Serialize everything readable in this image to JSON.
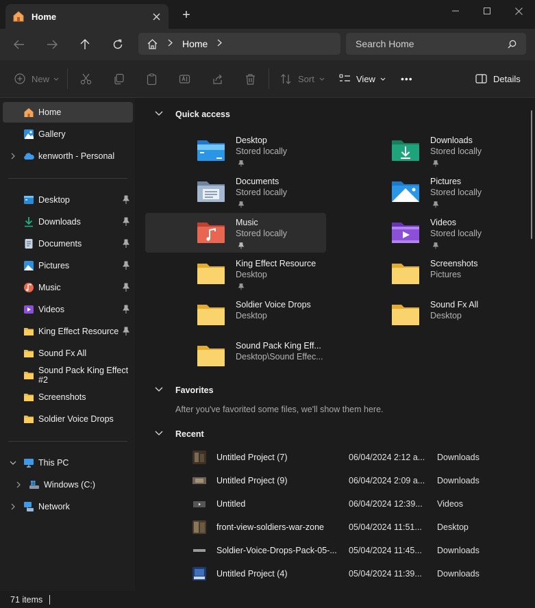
{
  "window": {
    "tab_title": "Home",
    "new_tab_symbol": "+"
  },
  "navbar": {
    "crumb_home": "Home",
    "search_placeholder": "Search Home"
  },
  "toolbar": {
    "new_label": "New",
    "sort_label": "Sort",
    "view_label": "View",
    "more_label": "•••",
    "details_label": "Details"
  },
  "sidebar": {
    "top_items": [
      {
        "label": "Home",
        "icon": "home-icon"
      },
      {
        "label": "Gallery",
        "icon": "gallery-icon"
      },
      {
        "label": "kenworth - Personal",
        "icon": "onedrive-cloud-icon"
      }
    ],
    "pinned_items": [
      {
        "label": "Desktop",
        "icon": "desktop-folder-icon"
      },
      {
        "label": "Downloads",
        "icon": "download-arrow-icon"
      },
      {
        "label": "Documents",
        "icon": "documents-icon"
      },
      {
        "label": "Pictures",
        "icon": "pictures-icon"
      },
      {
        "label": "Music",
        "icon": "music-icon"
      },
      {
        "label": "Videos",
        "icon": "videos-icon"
      },
      {
        "label": "King Effect Resource",
        "icon": "folder-icon"
      },
      {
        "label": "Sound Fx All",
        "icon": "folder-icon"
      },
      {
        "label": "Sound Pack King Effect #2",
        "icon": "folder-icon"
      },
      {
        "label": "Screenshots",
        "icon": "folder-icon"
      },
      {
        "label": "Soldier Voice Drops",
        "icon": "folder-icon"
      }
    ],
    "bottom_items": [
      {
        "label": "This PC",
        "icon": "computer-icon"
      },
      {
        "label": "Windows (C:)",
        "icon": "drive-icon"
      },
      {
        "label": "Network",
        "icon": "network-icon"
      }
    ]
  },
  "main": {
    "quick_access_title": "Quick access",
    "quick_access": [
      {
        "name": "Desktop",
        "sub": "Stored locally",
        "pinned": true,
        "icon": "desktop-folder-icon"
      },
      {
        "name": "Downloads",
        "sub": "Stored locally",
        "pinned": true,
        "icon": "downloads-folder-icon"
      },
      {
        "name": "Documents",
        "sub": "Stored locally",
        "pinned": true,
        "icon": "documents-folder-icon"
      },
      {
        "name": "Pictures",
        "sub": "Stored locally",
        "pinned": true,
        "icon": "pictures-folder-icon"
      },
      {
        "name": "Music",
        "sub": "Stored locally",
        "pinned": true,
        "icon": "music-folder-icon"
      },
      {
        "name": "Videos",
        "sub": "Stored locally",
        "pinned": true,
        "icon": "videos-folder-icon"
      },
      {
        "name": "King Effect Resource",
        "sub": "Desktop",
        "pinned": true,
        "icon": "folder-icon"
      },
      {
        "name": "Screenshots",
        "sub": "Pictures",
        "pinned": false,
        "icon": "folder-icon"
      },
      {
        "name": "Soldier Voice Drops",
        "sub": "Desktop",
        "pinned": false,
        "icon": "folder-icon"
      },
      {
        "name": "Sound Fx All",
        "sub": "Desktop",
        "pinned": false,
        "icon": "folder-icon"
      },
      {
        "name": "Sound Pack King Eff...",
        "sub": "Desktop\\Sound Effec...",
        "pinned": false,
        "icon": "folder-icon"
      }
    ],
    "favorites_title": "Favorites",
    "favorites_empty": "After you've favorited some files, we'll show them here.",
    "recent_title": "Recent",
    "recent": [
      {
        "name": "Untitled Project (7)",
        "date": "06/04/2024 2:12 a...",
        "location": "Downloads"
      },
      {
        "name": "Untitled Project (9)",
        "date": "06/04/2024 2:09 a...",
        "location": "Downloads"
      },
      {
        "name": "Untitled",
        "date": "06/04/2024 12:39...",
        "location": "Videos"
      },
      {
        "name": "front-view-soldiers-war-zone",
        "date": "05/04/2024 11:51...",
        "location": "Desktop"
      },
      {
        "name": "Soldier-Voice-Drops-Pack-05-...",
        "date": "05/04/2024 11:45...",
        "location": "Downloads"
      },
      {
        "name": "Untitled Project (4)",
        "date": "05/04/2024 11:39...",
        "location": "Downloads"
      }
    ]
  },
  "status": {
    "item_count": "71 items"
  },
  "colors": {
    "accent_blue": "#4aa3e8",
    "folder_yellow": "#f8cd5c",
    "downloads_teal": "#1fa37a",
    "music_red": "#e0585a",
    "videos_purple": "#8b4fd8"
  }
}
